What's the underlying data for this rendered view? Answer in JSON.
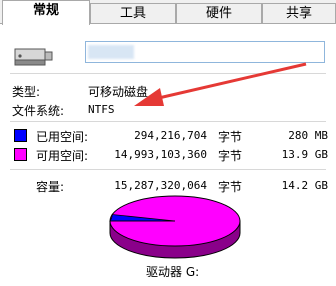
{
  "tabs": [
    {
      "label": "常规",
      "active": true
    },
    {
      "label": "工具",
      "active": false
    },
    {
      "label": "硬件",
      "active": false
    },
    {
      "label": "共享",
      "active": false
    }
  ],
  "general": {
    "name_value": "",
    "type_label": "类型:",
    "type_value": "可移动磁盘",
    "fs_label": "文件系统:",
    "fs_value": "NTFS"
  },
  "space": {
    "used_label": "已用空间:",
    "used_bytes": "294,216,704",
    "used_unit": "字节",
    "used_size": "280 MB",
    "free_label": "可用空间:",
    "free_bytes": "14,993,103,360",
    "free_unit": "字节",
    "free_size": "13.9 GB",
    "cap_label": "容量:",
    "cap_bytes": "15,287,320,064",
    "cap_unit": "字节",
    "cap_size": "14.2 GB",
    "drive_label": "驱动器 G:",
    "used_fraction": 0.019,
    "colors": {
      "used": "#0000ff",
      "free": "#ff00ff"
    }
  },
  "icons": [
    "usb-drive-icon",
    "red-arrow-annotation"
  ]
}
